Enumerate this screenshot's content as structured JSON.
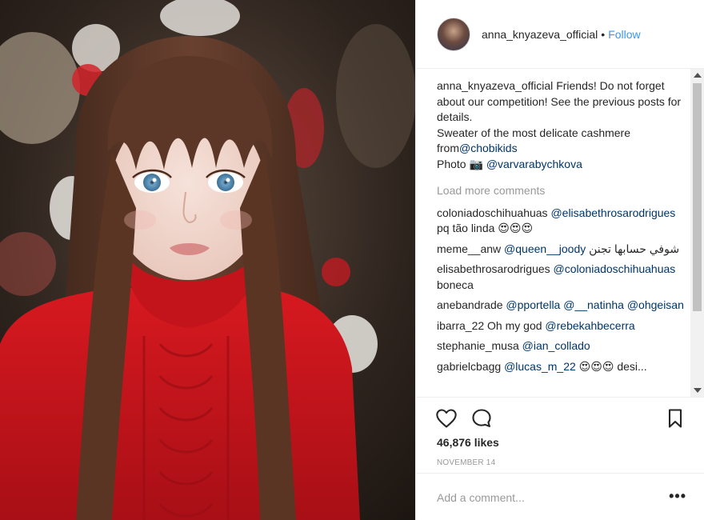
{
  "post": {
    "image_alt": "Girl with long brown hair and blue eyes wearing a red turtleneck sweater",
    "colors": {
      "sweater": "#c8141b",
      "hair": "#5a3524",
      "background": "#2b211c"
    }
  },
  "header": {
    "username": "anna_knyazeva_official",
    "separator": "•",
    "follow_label": "Follow"
  },
  "caption": {
    "username": "anna_knyazeva_official",
    "text_1": "Friends! Do not forget about our competition! See the previous posts for details.",
    "text_2": "Sweater of the most delicate cashmere from",
    "mention_1": "@chobikids",
    "text_3": "Photo 📷",
    "mention_2": "@varvarabychkova"
  },
  "load_more_label": "Load more comments",
  "comments": [
    {
      "user": "coloniadoschihuahuas",
      "mention": "@elisabethrosarodrigues",
      "text": "pq tão linda 😍😍😍"
    },
    {
      "user": "meme__anw",
      "mention": "@queen__joody",
      "text": "شوفي حسابها تجنن"
    },
    {
      "user": "elisabethrosarodrigues",
      "mention": "@coloniadoschihuahuas",
      "text": "boneca"
    },
    {
      "user": "anebandrade",
      "mention": "@pportella @__natinha @ohgeisan",
      "text": ""
    },
    {
      "user": "ibarra_22",
      "text": "Oh my god",
      "mention": "@rebekahbecerra"
    },
    {
      "user": "stephanie_musa",
      "mention": "@ian_collado",
      "text": ""
    },
    {
      "user": "gabrielcbagg",
      "mention": "@lucas_m_22",
      "text": "😍😍😍 desi..."
    }
  ],
  "actions": {
    "like_icon": "heart-icon",
    "comment_icon": "comment-icon",
    "save_icon": "bookmark-icon"
  },
  "likes_text": "46,876 likes",
  "date_text": "NOVEMBER 14",
  "add_comment": {
    "placeholder": "Add a comment...",
    "more_label": "•••"
  }
}
